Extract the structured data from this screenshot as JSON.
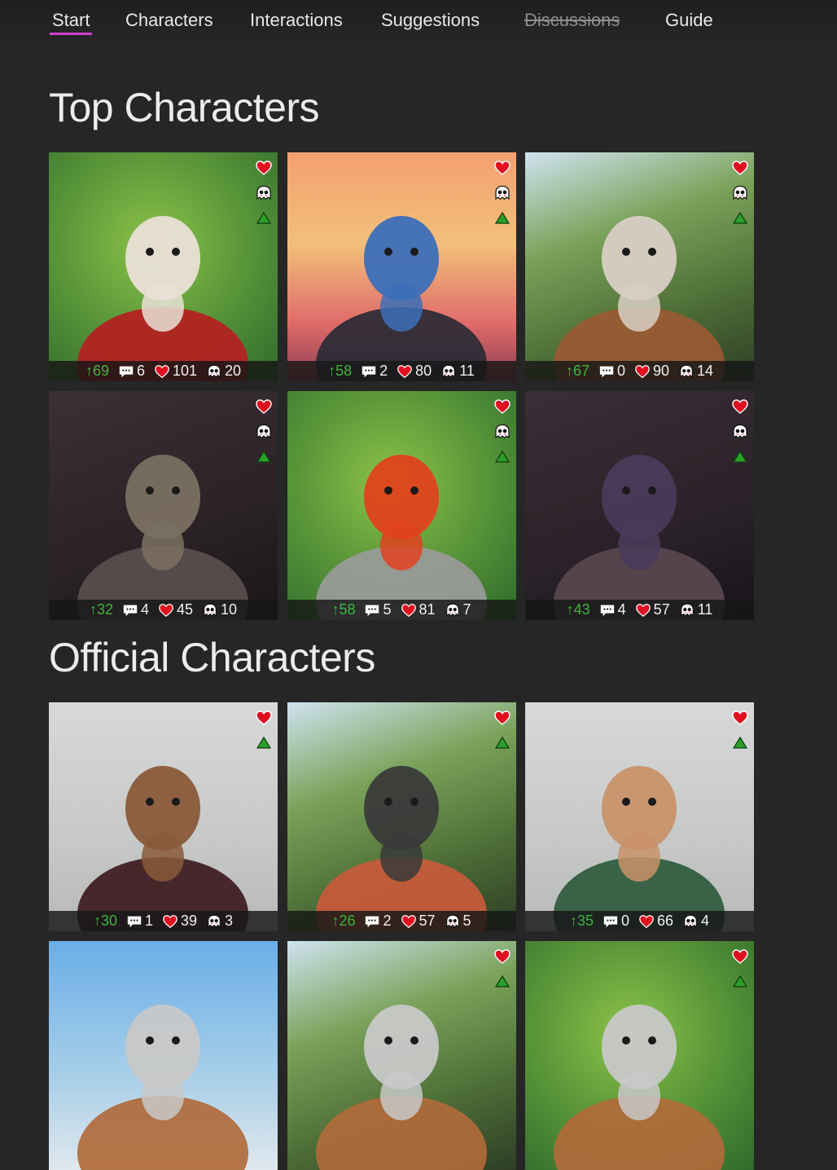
{
  "nav": {
    "items": [
      {
        "label": "Start",
        "active": true
      },
      {
        "label": "Characters"
      },
      {
        "label": "Interactions"
      },
      {
        "label": "Suggestions"
      },
      {
        "label": "Discussions",
        "struck": true
      },
      {
        "label": "Guide"
      }
    ]
  },
  "sections": {
    "top": {
      "title": "Top Characters"
    },
    "official": {
      "title": "Official Characters"
    }
  },
  "colors": {
    "accent_underline": "#d23fd0",
    "heart": "#e01020",
    "upvote": "#3fb43f",
    "triangle": "#2aa02a"
  },
  "top_characters": [
    {
      "subject": "reindeer in red corset",
      "bg": "green",
      "icons": [
        "heart-icon",
        "ghost-icon",
        "triangle-icon"
      ],
      "up": "↑69",
      "comments": "6",
      "likes": "101",
      "ghosts": "20"
    },
    {
      "subject": "horse with ponytail",
      "bg": "sunset",
      "icons": [
        "heart-icon",
        "ghost-icon",
        "triangle-icon"
      ],
      "up": "↑58",
      "comments": "2",
      "likes": "80",
      "ghosts": "11"
    },
    {
      "subject": "bull with horns",
      "bg": "forest",
      "icons": [
        "heart-icon",
        "ghost-icon",
        "triangle-icon"
      ],
      "up": "↑67",
      "comments": "0",
      "likes": "90",
      "ghosts": "14"
    },
    {
      "subject": "crocodile in hoodie",
      "bg": "dark",
      "icons": [
        "heart-icon",
        "ghost-icon",
        "triangle-icon"
      ],
      "up": "↑32",
      "comments": "4",
      "likes": "45",
      "ghosts": "10"
    },
    {
      "subject": "grey wolf with red hair",
      "bg": "green",
      "icons": [
        "heart-icon",
        "ghost-icon",
        "triangle-icon"
      ],
      "up": "↑58",
      "comments": "5",
      "likes": "81",
      "ghosts": "7"
    },
    {
      "subject": "dark feline with purple hair",
      "bg": "dusk",
      "icons": [
        "heart-icon",
        "ghost-icon",
        "triangle-icon"
      ],
      "up": "↑43",
      "comments": "4",
      "likes": "57",
      "ghosts": "11"
    }
  ],
  "official_characters": [
    {
      "subject": "reindeer in tuxedo",
      "bg": "grey",
      "icons": [
        "heart-icon",
        "triangle-icon"
      ],
      "up": "↑30",
      "comments": "1",
      "likes": "39",
      "ghosts": "3"
    },
    {
      "subject": "dragon in plaid shirt",
      "bg": "forest",
      "icons": [
        "heart-icon",
        "triangle-icon"
      ],
      "up": "↑26",
      "comments": "2",
      "likes": "57",
      "ghosts": "5"
    },
    {
      "subject": "deer in green dress",
      "bg": "grey",
      "icons": [
        "heart-icon",
        "triangle-icon"
      ],
      "up": "↑35",
      "comments": "0",
      "likes": "66",
      "ghosts": "4"
    },
    {
      "subject": "partial",
      "bg": "sky",
      "icons": [],
      "up": "",
      "comments": "",
      "likes": "",
      "ghosts": ""
    },
    {
      "subject": "partial",
      "bg": "forest",
      "icons": [
        "heart-icon",
        "triangle-icon"
      ],
      "up": "",
      "comments": "",
      "likes": "",
      "ghosts": ""
    },
    {
      "subject": "partial",
      "bg": "green",
      "icons": [
        "heart-icon",
        "triangle-icon"
      ],
      "up": "",
      "comments": "",
      "likes": "",
      "ghosts": ""
    }
  ]
}
